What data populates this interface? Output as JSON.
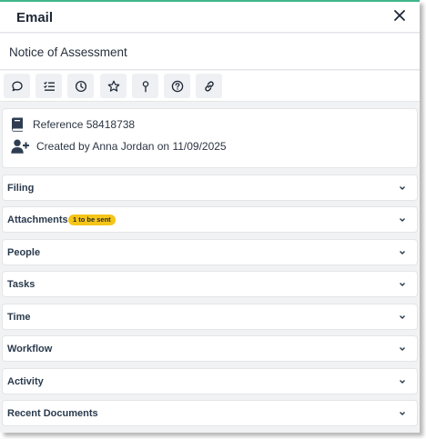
{
  "panel": {
    "title": "Email",
    "subject": "Notice of Assessment",
    "accent_color": "#3fb68a"
  },
  "toolbar": {
    "buttons": [
      {
        "icon": "comment-icon"
      },
      {
        "icon": "checklist-icon"
      },
      {
        "icon": "clock-icon"
      },
      {
        "icon": "star-icon"
      },
      {
        "icon": "pin-icon"
      },
      {
        "icon": "help-icon"
      },
      {
        "icon": "link-icon"
      }
    ]
  },
  "info": {
    "reference": "Reference 58418738",
    "created": "Created by Anna Jordan on 11/09/2025"
  },
  "sections": {
    "filing": "Filing",
    "attachments": "Attachments",
    "attachments_badge": "1 to be sent",
    "people": "People",
    "tasks": "Tasks",
    "time": "Time",
    "workflow": "Workflow",
    "activity": "Activity",
    "recent_documents": "Recent Documents"
  }
}
